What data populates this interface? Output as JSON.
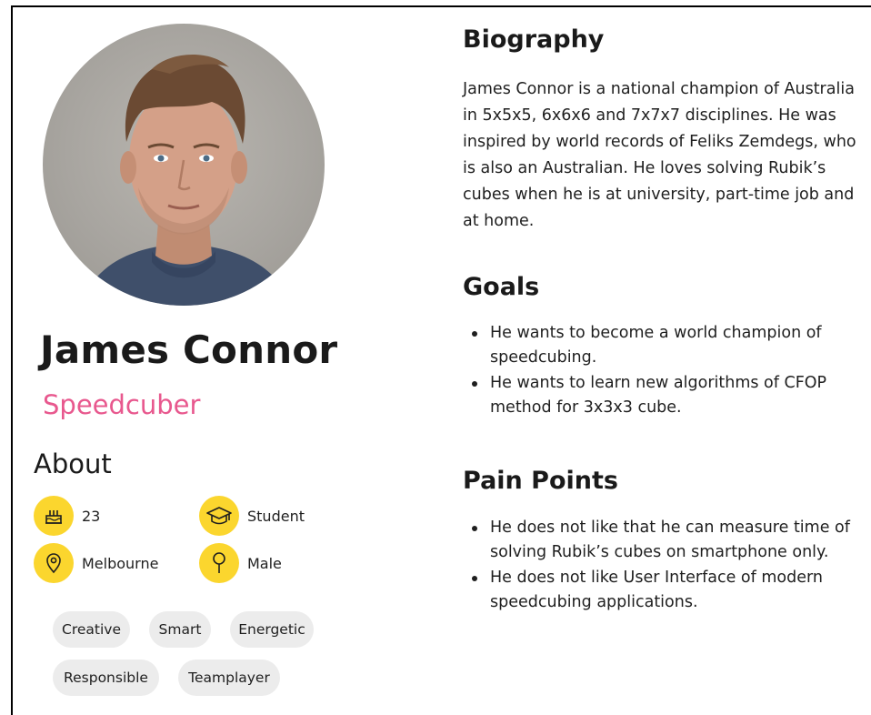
{
  "profile": {
    "name": "James Connor",
    "role": "Speedcuber",
    "photo_icon": "person-photo"
  },
  "about": {
    "title": "About",
    "stats": {
      "age": {
        "value": "23",
        "icon": "birthday-cake-icon"
      },
      "occupation": {
        "value": "Student",
        "icon": "graduation-cap-icon"
      },
      "city": {
        "value": "Melbourne",
        "icon": "location-pin-icon"
      },
      "gender": {
        "value": "Male",
        "icon": "gender-icon"
      }
    },
    "tags": [
      "Creative",
      "Smart",
      "Energetic",
      "Responsible",
      "Teamplayer"
    ]
  },
  "biography": {
    "title": "Biography",
    "text": "James Connor is a national champion of Australia in 5x5x5, 6x6x6 and 7x7x7 disciplines. He was inspired by world records of Feliks Zemdegs, who is also an Australian. He loves solving Rubik’s cubes when he is at university, part-time job and at home."
  },
  "goals": {
    "title": "Goals",
    "items": [
      "He wants to become a world champion of speedcubing.",
      "He wants to learn new algorithms of CFOP method for 3x3x3 cube."
    ]
  },
  "pain_points": {
    "title": "Pain Points",
    "items": [
      "He does not like that he can measure time of solving Rubik’s cubes on smartphone only.",
      "He does not like User Interface of modern speedcubing applications."
    ]
  },
  "colors": {
    "accent_pink": "#e8588e",
    "icon_yellow": "#fbd62e",
    "tag_gray": "#ececec"
  }
}
